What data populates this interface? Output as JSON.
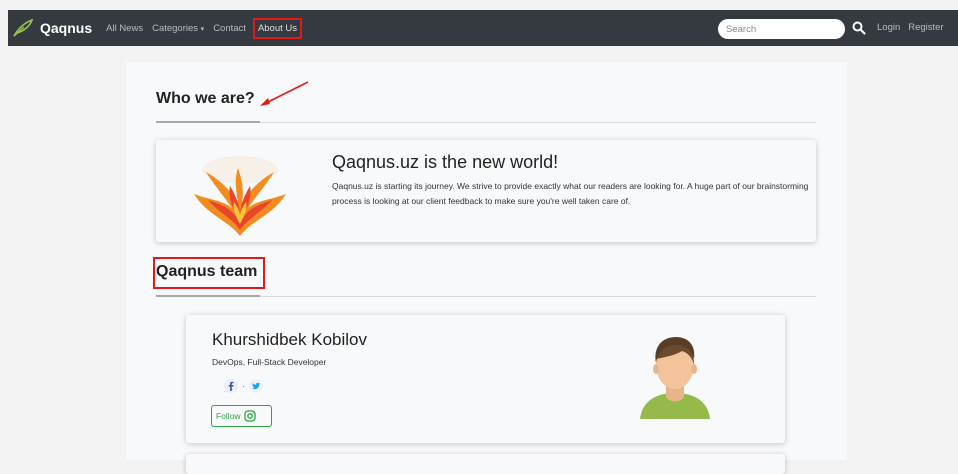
{
  "navbar": {
    "brand": "Qaqnus",
    "links": [
      "All News",
      "Categories",
      "Contact",
      "About Us"
    ],
    "categories_caret": "▾",
    "search_placeholder": "Search",
    "login": "Login",
    "register": "Register"
  },
  "about": {
    "title": "Who we are?",
    "hero_title": "Qaqnus.uz is the new world!",
    "hero_text": "Qaqnus.uz is starting its journey. We strive to provide exactly what our readers are looking for. A huge part of our brainstorming process is looking at our client feedback to make sure you're well taken care of."
  },
  "team": {
    "title": "Qaqnus team",
    "members": [
      {
        "name": "Khurshidbek Kobilov",
        "role": "DevOps, Full-Stack Developer",
        "social_separator": "·",
        "follow_label": "Follow"
      }
    ]
  },
  "colors": {
    "navbar_bg": "#343a40",
    "annotation_red": "#e01a1a",
    "follow_green": "#28a745",
    "facebook_blue": "#3b5998",
    "twitter_blue": "#1da1f2"
  }
}
